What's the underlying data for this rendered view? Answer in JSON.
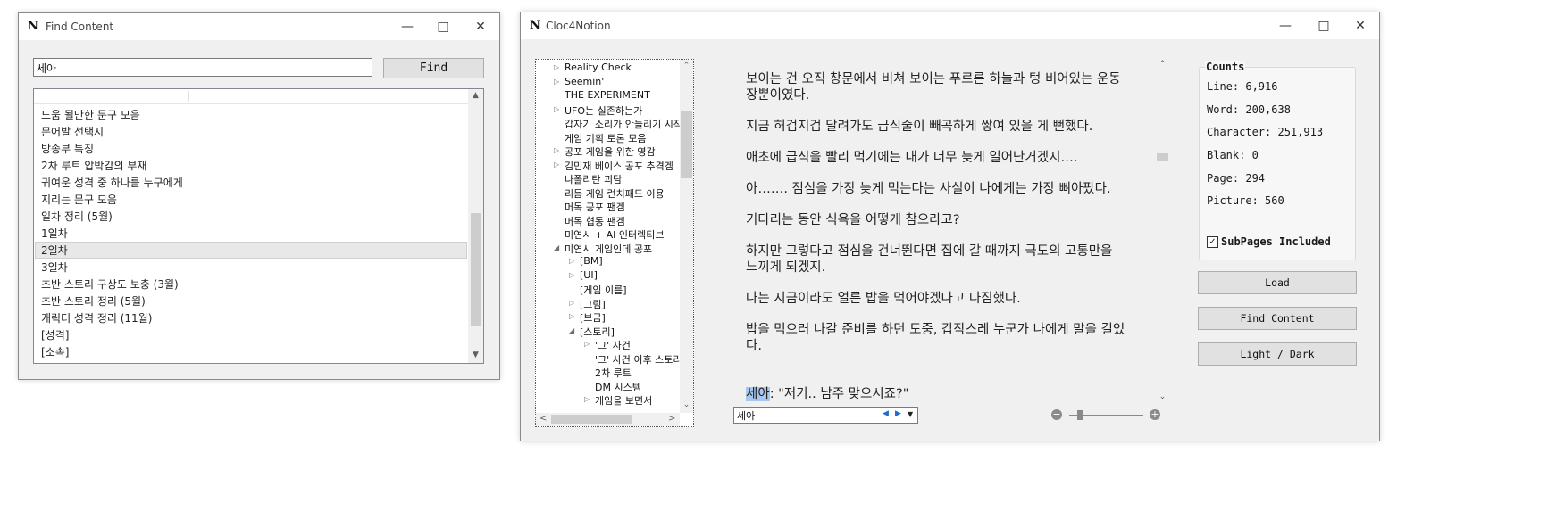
{
  "find_window": {
    "logo": "N",
    "title": "Find Content",
    "search_value": "세아",
    "find_label": "Find",
    "results": [
      "도움 될만한 문구 모음",
      "문어발 선택지",
      "방송부 특징",
      "2차 루트 압박감의 부재",
      "귀여운 성격 중 하나를 누구에게",
      "지리는 문구 모음",
      "일차 정리 (5월)",
      "1일차",
      "2일차",
      "3일차",
      "초반 스토리 구상도 보충 (3월)",
      "초반 스토리 정리 (5월)",
      "캐릭터 성격 정리 (11월)",
      "[성격]",
      "[소속]"
    ],
    "selected_index": 8
  },
  "main_window": {
    "logo": "N",
    "title": "Cloc4Notion",
    "tree": [
      {
        "label": "Reality Check",
        "indent": 0,
        "expander": "collapsed"
      },
      {
        "label": "Seemin'",
        "indent": 0,
        "expander": "collapsed"
      },
      {
        "label": "THE EXPERIMENT",
        "indent": 0,
        "expander": "none"
      },
      {
        "label": "UFO는 실존하는가",
        "indent": 0,
        "expander": "collapsed"
      },
      {
        "label": "갑자기 소리가 안들리기 시작",
        "indent": 0,
        "expander": "none"
      },
      {
        "label": "게임 기획 토론 모음",
        "indent": 0,
        "expander": "none"
      },
      {
        "label": "공포 게임을 위한 영감",
        "indent": 0,
        "expander": "collapsed"
      },
      {
        "label": "김민재 베이스 공포 추격겜",
        "indent": 0,
        "expander": "collapsed"
      },
      {
        "label": "나폴리탄 괴담",
        "indent": 0,
        "expander": "none"
      },
      {
        "label": "리듬 게임 런치패드 이용",
        "indent": 0,
        "expander": "none"
      },
      {
        "label": "머독 공포 팬겜",
        "indent": 0,
        "expander": "none"
      },
      {
        "label": "머독 협동 팬겜",
        "indent": 0,
        "expander": "none"
      },
      {
        "label": "미연시 + AI 인터렉티브",
        "indent": 0,
        "expander": "none"
      },
      {
        "label": "미연시 게임인데 공포",
        "indent": 0,
        "expander": "expanded"
      },
      {
        "label": "[BM]",
        "indent": 1,
        "expander": "collapsed"
      },
      {
        "label": "[UI]",
        "indent": 1,
        "expander": "collapsed"
      },
      {
        "label": "[게임 이름]",
        "indent": 1,
        "expander": "none"
      },
      {
        "label": "[그림]",
        "indent": 1,
        "expander": "collapsed"
      },
      {
        "label": "[브금]",
        "indent": 1,
        "expander": "collapsed"
      },
      {
        "label": "[스토리]",
        "indent": 1,
        "expander": "expanded"
      },
      {
        "label": "'그' 사건",
        "indent": 2,
        "expander": "collapsed"
      },
      {
        "label": "'그' 사건 이후 스토리",
        "indent": 2,
        "expander": "none"
      },
      {
        "label": "2차 루트",
        "indent": 2,
        "expander": "none"
      },
      {
        "label": "DM 시스템",
        "indent": 2,
        "expander": "none"
      },
      {
        "label": "게임을 보면서",
        "indent": 2,
        "expander": "collapsed"
      }
    ],
    "paragraphs": [
      {
        "lines": [
          "보이는 건 오직 창문에서 비쳐 보이는 푸르른 하늘과 텅 비어있는 운동",
          "장뿐이였다."
        ]
      },
      {
        "lines": [
          "지금 허겁지겁 달려가도 급식줄이 빼곡하게 쌓여 있을 게 뻔했다."
        ]
      },
      {
        "lines": [
          "애초에 급식을 빨리 먹기에는 내가 너무 늦게 일어난거겠지…."
        ]
      },
      {
        "lines": [
          "아……. 점심을 가장 늦게 먹는다는 사실이 나에게는 가장 뼈아팠다."
        ]
      },
      {
        "lines": [
          "기다리는 동안 식욕을 어떻게 참으라고?"
        ]
      },
      {
        "lines": [
          "하지만 그렇다고 점심을 건너뛴다면 집에 갈 때까지 극도의 고통만을",
          "느끼게 되겠지."
        ]
      },
      {
        "lines": [
          "나는 지금이라도 얼른 밥을 먹어야겠다고 다짐했다."
        ]
      },
      {
        "lines": [
          "밥을 먹으러 나갈 준비를 하던 도중, 갑작스레 누군가 나에게 말을 걸었",
          "다."
        ]
      }
    ],
    "last_line_highlight": "세아",
    "last_line_rest": ": \"저기.. 남주 맞으시죠?\"",
    "search_value": "세아",
    "counts": {
      "title": "Counts",
      "line": "Line: 6,916",
      "word": "Word: 200,638",
      "character": "Character: 251,913",
      "blank": "Blank: 0",
      "page": "Page: 294",
      "picture": "Picture: 560"
    },
    "subpages_label": "SubPages Included",
    "subpages_checked": true,
    "buttons": {
      "load": "Load",
      "find_content": "Find Content",
      "light_dark": "Light / Dark"
    },
    "zoom_level": 0.15
  },
  "icons": {
    "minimize": "minimize-icon",
    "maximize": "maximize-icon",
    "close": "close-icon"
  }
}
